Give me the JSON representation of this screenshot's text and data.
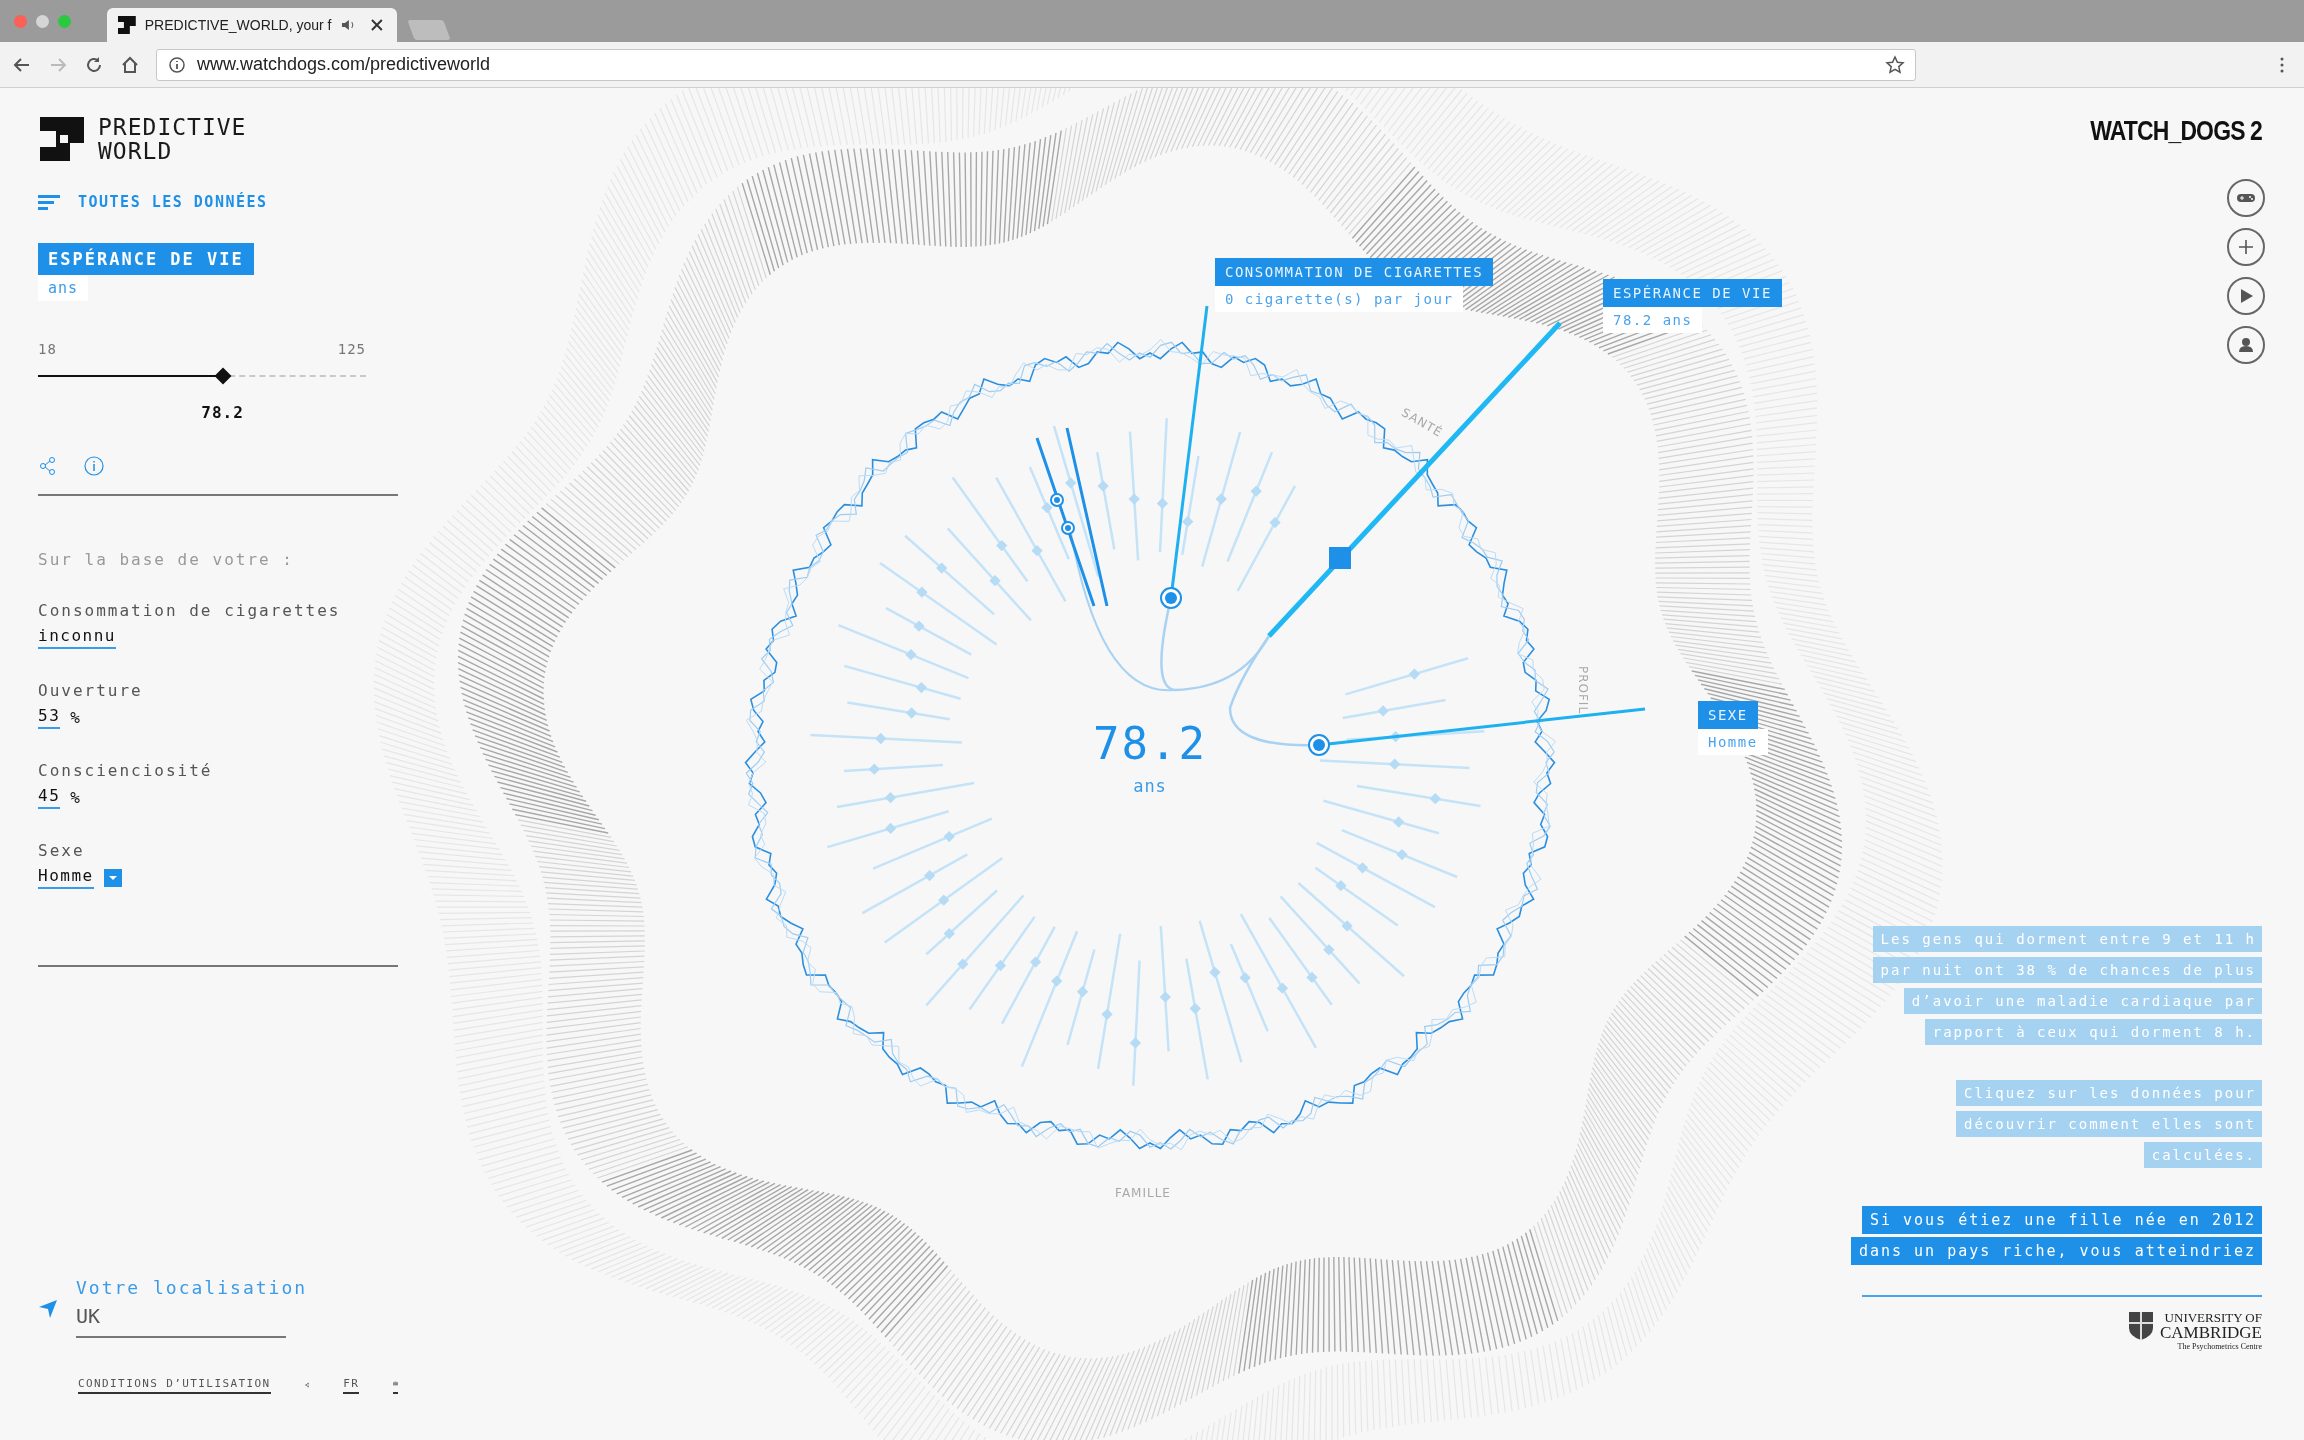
{
  "browser": {
    "tab_title": "PREDICTIVE_WORLD, your f",
    "url": "www.watchdogs.com/predictiveworld"
  },
  "brand": {
    "lines": [
      "PREDICTIVE",
      "WORLD"
    ]
  },
  "menu": {
    "label": "TOUTES LES DONNÉES"
  },
  "metric": {
    "title": "ESPÉRANCE DE VIE",
    "unit": "ans",
    "min": "18",
    "max": "125",
    "value": "78.2",
    "level": 0.5626
  },
  "based_on": {
    "heading": "Sur la base de votre :",
    "factors": [
      {
        "label": "Consommation de cigarettes",
        "value": "inconnu",
        "kind": "text"
      },
      {
        "label": "Ouverture",
        "value": "53",
        "unit": "%",
        "kind": "percent"
      },
      {
        "label": "Conscienciosité",
        "value": "45",
        "unit": "%",
        "kind": "percent"
      },
      {
        "label": "Sexe",
        "value": "Homme",
        "kind": "dropdown"
      }
    ]
  },
  "location": {
    "label": "Votre localisation",
    "value": "UK"
  },
  "footer": {
    "terms": "CONDITIONS D’UTILISATION",
    "language": "FR"
  },
  "chart": {
    "center_value": "78.2",
    "center_unit": "ans",
    "axis_labels": [
      "SANTÉ",
      "PROFIL",
      "FAMILLE"
    ],
    "callouts": [
      {
        "title": "CONSOMMATION DE CIGARETTES",
        "value": "0 cigarette(s) par jour"
      },
      {
        "title": "ESPÉRANCE DE VIE",
        "value": "78.2 ans"
      },
      {
        "title": "SEXE",
        "value": "Homme"
      }
    ]
  },
  "game_logo": "WATCH_DOGS 2",
  "info_blocks": [
    {
      "kind": "fact",
      "lines": [
        "Les gens qui dorment entre 9 et 11 h",
        "par nuit ont 38 % de chances de plus",
        "d’avoir une maladie cardiaque par",
        "rapport à ceux qui dorment 8 h."
      ]
    },
    {
      "kind": "hint",
      "lines": [
        "Cliquez sur les données pour",
        "découvrir comment elles sont",
        "calculées."
      ]
    },
    {
      "kind": "statement",
      "lines": [
        "Si vous étiez une fille née en 2012",
        "dans un pays riche, vous atteindriez"
      ]
    }
  ],
  "partner": {
    "lines": [
      "UNIVERSITY OF",
      "CAMBRIDGE",
      "The Psychometrics Centre"
    ]
  }
}
